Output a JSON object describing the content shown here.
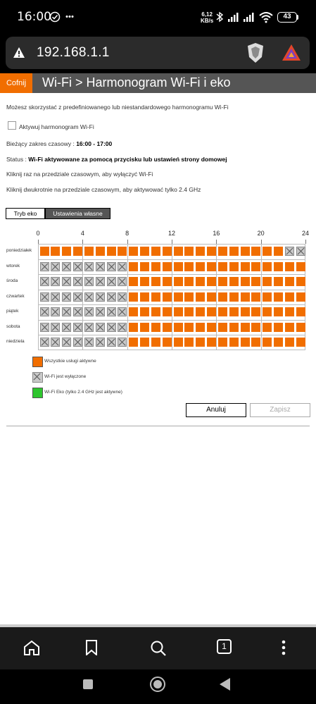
{
  "status_bar": {
    "time": "16:00",
    "speed_value": "6,12",
    "speed_unit": "KB/s",
    "battery": "43"
  },
  "browser": {
    "url": "192.168.1.1"
  },
  "page": {
    "back_label": "Cofnij",
    "title": "Wi-Fi > Harmonogram Wi-Fi i eko",
    "intro": "Możesz skorzystać z predefiniowanego lub niestandardowego harmonogramu Wi-Fi",
    "enable_label": "Aktywuj harmonogram Wi-Fi",
    "range_prefix": "Bieżący zakres czasowy : ",
    "range_value": "16:00 - 17:00",
    "status_prefix": "Status : ",
    "status_value": "Wi-Fi aktywowane za pomocą przycisku lub ustawień strony domowej",
    "hint_single": "Kliknij raz na przedziale czasowym, aby wyłączyć Wi-Fi",
    "hint_double": "Kliknij dwukrotnie na przedziale czasowym, aby aktywować tylko 2.4 GHz",
    "tabs": [
      "Tryb eko",
      "Ustawienia własne"
    ],
    "hour_labels": [
      "0",
      "4",
      "8",
      "12",
      "16",
      "20",
      "24"
    ],
    "days": [
      {
        "label": "poniedziałek",
        "off_hours": [
          22,
          23
        ]
      },
      {
        "label": "wtorek",
        "off_hours": [
          0,
          1,
          2,
          3,
          4,
          5,
          6,
          7
        ]
      },
      {
        "label": "środa",
        "off_hours": [
          0,
          1,
          2,
          3,
          4,
          5,
          6,
          7
        ]
      },
      {
        "label": "czwartek",
        "off_hours": [
          0,
          1,
          2,
          3,
          4,
          5,
          6,
          7
        ]
      },
      {
        "label": "piątek",
        "off_hours": [
          0,
          1,
          2,
          3,
          4,
          5,
          6,
          7
        ]
      },
      {
        "label": "sobota",
        "off_hours": [
          0,
          1,
          2,
          3,
          4,
          5,
          6,
          7
        ]
      },
      {
        "label": "niedziela",
        "off_hours": [
          0,
          1,
          2,
          3,
          4,
          5,
          6,
          7
        ]
      }
    ],
    "legend": [
      {
        "text": "Wszystkie usługi aktywne",
        "color": "#f16e00"
      },
      {
        "text": "Wi-Fi jest wyłączone",
        "color": "#c9c9c9"
      },
      {
        "text": "Wi-Fi Eko (tylko 2.4 GHz jest aktywne)",
        "color": "#2ec52e"
      }
    ],
    "cancel_label": "Anuluj",
    "save_label": "Zapisz"
  },
  "bottom_nav": {
    "tab_count": "1"
  },
  "colors": {
    "accent": "#f16e00",
    "header_gray": "#555555",
    "eco_green": "#2ec52e"
  }
}
